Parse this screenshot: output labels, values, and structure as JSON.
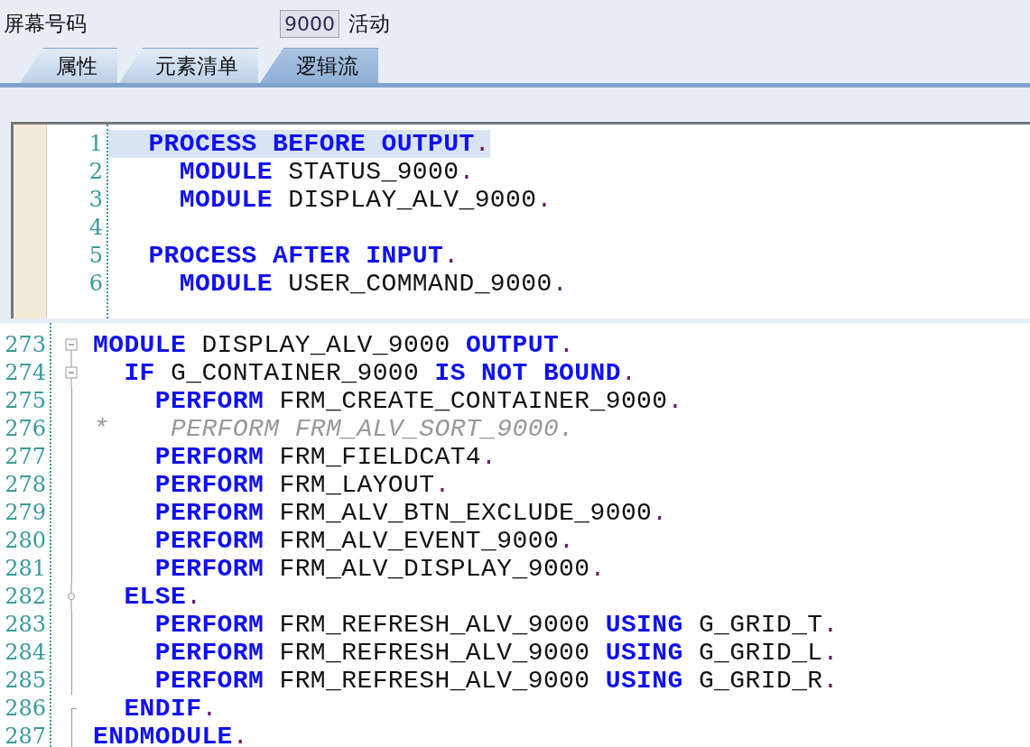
{
  "header": {
    "label": "屏幕号码",
    "screen_number": "9000",
    "status": "活动"
  },
  "tabs": [
    {
      "label": "属性",
      "selected": false
    },
    {
      "label": "元素清单",
      "selected": false
    },
    {
      "label": "逻辑流",
      "selected": true
    }
  ],
  "flow_editor": {
    "lines": [
      {
        "number": "1",
        "highlighted": true,
        "tokens": [
          {
            "kind": "kw",
            "text": "  PROCESS BEFORE OUTPUT"
          },
          {
            "kind": "punct",
            "text": "."
          }
        ]
      },
      {
        "number": "2",
        "highlighted": false,
        "tokens": [
          {
            "kind": "kw",
            "text": "    MODULE"
          },
          {
            "kind": "id",
            "text": " STATUS_9000"
          },
          {
            "kind": "punct",
            "text": "."
          }
        ]
      },
      {
        "number": "3",
        "highlighted": false,
        "tokens": [
          {
            "kind": "kw",
            "text": "    MODULE"
          },
          {
            "kind": "id",
            "text": " DISPLAY_ALV_9000"
          },
          {
            "kind": "punct",
            "text": "."
          }
        ]
      },
      {
        "number": "4",
        "highlighted": false
      },
      {
        "number": "5",
        "highlighted": false,
        "tokens": [
          {
            "kind": "kw",
            "text": "  PROCESS AFTER INPUT"
          },
          {
            "kind": "punct",
            "text": "."
          }
        ]
      },
      {
        "number": "6",
        "highlighted": false,
        "tokens": [
          {
            "kind": "kw",
            "text": "    MODULE"
          },
          {
            "kind": "id",
            "text": " USER_COMMAND_9000"
          },
          {
            "kind": "punct",
            "text": "."
          }
        ]
      }
    ]
  },
  "module_editor": {
    "lines": [
      {
        "number": "273",
        "kind": "open",
        "tokens": [
          {
            "kind": "kw",
            "text": "MODULE"
          },
          {
            "kind": "id",
            "text": " DISPLAY_ALV_9000 "
          },
          {
            "kind": "kw",
            "text": "OUTPUT"
          },
          {
            "kind": "punct",
            "text": "."
          }
        ]
      },
      {
        "number": "274",
        "kind": "nested",
        "tokens": [
          {
            "kind": "kw",
            "text": "  IF"
          },
          {
            "kind": "id",
            "text": " G_CONTAINER_9000 "
          },
          {
            "kind": "kw",
            "text": "IS NOT BOUND"
          },
          {
            "kind": "punct",
            "text": "."
          }
        ]
      },
      {
        "number": "275",
        "kind": "inner",
        "tokens": [
          {
            "kind": "kw",
            "text": "    PERFORM"
          },
          {
            "kind": "id",
            "text": " FRM_CREATE_CONTAINER_9000"
          },
          {
            "kind": "punct",
            "text": "."
          }
        ]
      },
      {
        "number": "276",
        "kind": "inner",
        "tokens": [
          {
            "kind": "comment",
            "text": "*    PERFORM FRM_ALV_SORT_9000."
          }
        ]
      },
      {
        "number": "277",
        "kind": "inner",
        "tokens": [
          {
            "kind": "kw",
            "text": "    PERFORM"
          },
          {
            "kind": "id",
            "text": " FRM_FIELDCAT4"
          },
          {
            "kind": "punct",
            "text": "."
          }
        ]
      },
      {
        "number": "278",
        "kind": "inner",
        "tokens": [
          {
            "kind": "kw",
            "text": "    PERFORM"
          },
          {
            "kind": "id",
            "text": " FRM_LAYOUT"
          },
          {
            "kind": "punct",
            "text": "."
          }
        ]
      },
      {
        "number": "279",
        "kind": "inner",
        "tokens": [
          {
            "kind": "kw",
            "text": "    PERFORM"
          },
          {
            "kind": "id",
            "text": " FRM_ALV_BTN_EXCLUDE_9000"
          },
          {
            "kind": "punct",
            "text": "."
          }
        ]
      },
      {
        "number": "280",
        "kind": "inner",
        "tokens": [
          {
            "kind": "kw",
            "text": "    PERFORM"
          },
          {
            "kind": "id",
            "text": " FRM_ALV_EVENT_9000"
          },
          {
            "kind": "punct",
            "text": "."
          }
        ]
      },
      {
        "number": "281",
        "kind": "inner",
        "tokens": [
          {
            "kind": "kw",
            "text": "    PERFORM"
          },
          {
            "kind": "id",
            "text": " FRM_ALV_DISPLAY_9000"
          },
          {
            "kind": "punct",
            "text": "."
          }
        ]
      },
      {
        "number": "282",
        "kind": "branch",
        "tokens": [
          {
            "kind": "kw",
            "text": "  ELSE"
          },
          {
            "kind": "punct",
            "text": "."
          }
        ]
      },
      {
        "number": "283",
        "kind": "inner",
        "tokens": [
          {
            "kind": "kw",
            "text": "    PERFORM"
          },
          {
            "kind": "id",
            "text": " FRM_REFRESH_ALV_9000 "
          },
          {
            "kind": "kw",
            "text": "USING"
          },
          {
            "kind": "id",
            "text": " G_GRID_T"
          },
          {
            "kind": "punct",
            "text": "."
          }
        ]
      },
      {
        "number": "284",
        "kind": "inner",
        "tokens": [
          {
            "kind": "kw",
            "text": "    PERFORM"
          },
          {
            "kind": "id",
            "text": " FRM_REFRESH_ALV_9000 "
          },
          {
            "kind": "kw",
            "text": "USING"
          },
          {
            "kind": "id",
            "text": " G_GRID_L"
          },
          {
            "kind": "punct",
            "text": "."
          }
        ]
      },
      {
        "number": "285",
        "kind": "inner",
        "tokens": [
          {
            "kind": "kw",
            "text": "    PERFORM"
          },
          {
            "kind": "id",
            "text": " FRM_REFRESH_ALV_9000 "
          },
          {
            "kind": "kw",
            "text": "USING"
          },
          {
            "kind": "id",
            "text": " G_GRID_R"
          },
          {
            "kind": "punct",
            "text": "."
          }
        ]
      },
      {
        "number": "286",
        "kind": "close",
        "tokens": [
          {
            "kind": "kw",
            "text": "  ENDIF"
          },
          {
            "kind": "punct",
            "text": "."
          }
        ]
      },
      {
        "number": "287",
        "kind": "end",
        "tokens": [
          {
            "kind": "kw",
            "text": "ENDMODULE"
          },
          {
            "kind": "punct",
            "text": "."
          }
        ]
      }
    ]
  }
}
